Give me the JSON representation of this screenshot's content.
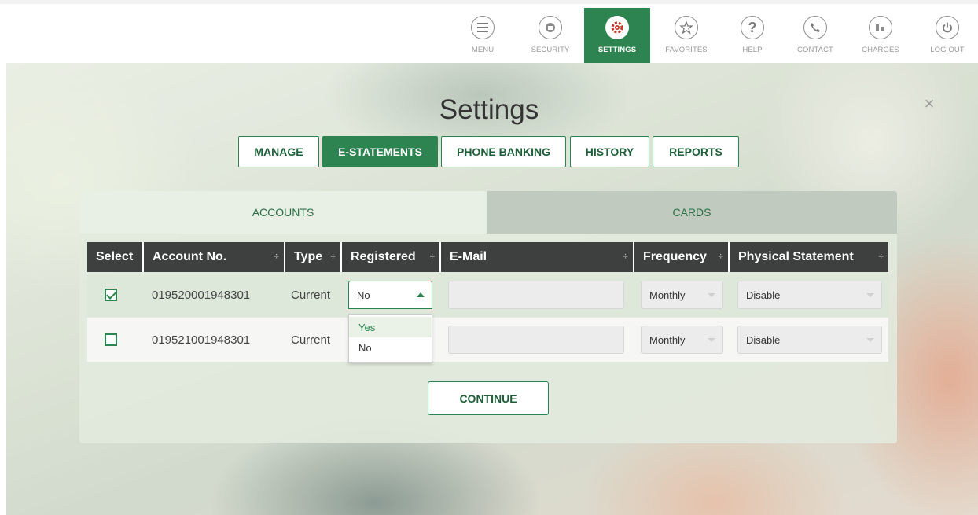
{
  "nav": {
    "items": [
      {
        "label": "MENU",
        "icon": "menu-icon"
      },
      {
        "label": "SECURITY",
        "icon": "security-icon"
      },
      {
        "label": "SETTINGS",
        "icon": "gear-icon",
        "active": true
      },
      {
        "label": "FAVORITES",
        "icon": "star-icon"
      },
      {
        "label": "HELP",
        "icon": "question-icon"
      },
      {
        "label": "CONTACT",
        "icon": "phone-icon"
      },
      {
        "label": "CHARGES",
        "icon": "charges-icon"
      },
      {
        "label": "LOG OUT",
        "icon": "power-icon"
      }
    ]
  },
  "page": {
    "title": "Settings",
    "close_symbol": "×"
  },
  "tabs": [
    {
      "label": "MANAGE",
      "active": false
    },
    {
      "label": "E-STATEMENTS",
      "active": true
    },
    {
      "label": "PHONE BANKING",
      "active": false
    },
    {
      "label": "HISTORY",
      "active": false
    },
    {
      "label": "REPORTS",
      "active": false
    }
  ],
  "subtabs": {
    "accounts": "ACCOUNTS",
    "cards": "CARDS"
  },
  "table": {
    "headers": [
      "Select",
      "Account No.",
      "Type",
      "Registered",
      "E-Mail",
      "Frequency",
      "Physical Statement"
    ],
    "sort_glyph": "÷",
    "rows": [
      {
        "selected": true,
        "account": "019520001948301",
        "type": "Current",
        "registered": "No",
        "email": "",
        "frequency": "Monthly",
        "physical": "Disable"
      },
      {
        "selected": false,
        "account": "019521001948301",
        "type": "Current",
        "registered": "No",
        "email": "",
        "frequency": "Monthly",
        "physical": "Disable"
      }
    ]
  },
  "registered_dropdown": {
    "options": [
      "Yes",
      "No"
    ],
    "highlighted": "Yes"
  },
  "actions": {
    "continue_label": "CONTINUE"
  },
  "colors": {
    "brand_green": "#2e8451",
    "header_dark": "#3e4040"
  }
}
